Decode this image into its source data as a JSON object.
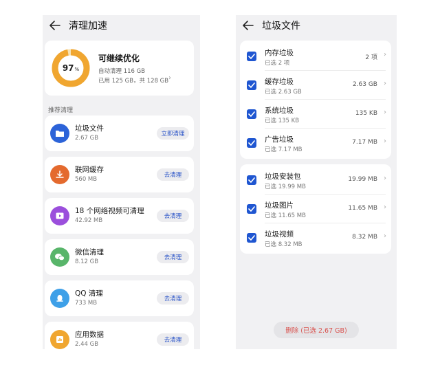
{
  "left": {
    "title": "清理加速",
    "summary": {
      "percent": "97",
      "percent_unit": "%",
      "progress": 0.97,
      "title": "可继续优化",
      "auto_clean": "自动清理 116 GB",
      "usage": "已用 125 GB，共 128 GB"
    },
    "section_label": "推荐清理",
    "items": [
      {
        "name": "垃圾文件",
        "size": "2.67 GB",
        "button": "立即清理",
        "icon": "folder-icon",
        "color": "#2c63d8"
      },
      {
        "name": "联网缓存",
        "size": "560 MB",
        "button": "去清理",
        "icon": "download-icon",
        "color": "#e46a2e"
      },
      {
        "name": "18 个网络视频可清理",
        "size": "42.92 MB",
        "button": "去清理",
        "icon": "video-icon",
        "color": "#9b4fdc"
      },
      {
        "name": "微信清理",
        "size": "8.12 GB",
        "button": "去清理",
        "icon": "wechat-icon",
        "color": "#58b56a"
      },
      {
        "name": "QQ 清理",
        "size": "733 MB",
        "button": "去清理",
        "icon": "qq-icon",
        "color": "#3ea0e8"
      },
      {
        "name": "应用数据",
        "size": "2.44 GB",
        "button": "去清理",
        "icon": "app-data-icon",
        "color": "#f0a630"
      }
    ]
  },
  "right": {
    "title": "垃圾文件",
    "group1": [
      {
        "name": "内存垃圾",
        "sub": "已选 2 项",
        "size": "2 项"
      },
      {
        "name": "缓存垃圾",
        "sub": "已选 2.63 GB",
        "size": "2.63 GB"
      },
      {
        "name": "系统垃圾",
        "sub": "已选 135 KB",
        "size": "135 KB"
      },
      {
        "name": "广告垃圾",
        "sub": "已选 7.17 MB",
        "size": "7.17 MB"
      }
    ],
    "group2": [
      {
        "name": "垃圾安装包",
        "sub": "已选 19.99 MB",
        "size": "19.99 MB"
      },
      {
        "name": "垃圾图片",
        "sub": "已选 11.65 MB",
        "size": "11.65 MB"
      },
      {
        "name": "垃圾视频",
        "sub": "已选 8.32 MB",
        "size": "8.32 MB"
      }
    ],
    "delete_button": "删除 (已选 2.67 GB)"
  }
}
